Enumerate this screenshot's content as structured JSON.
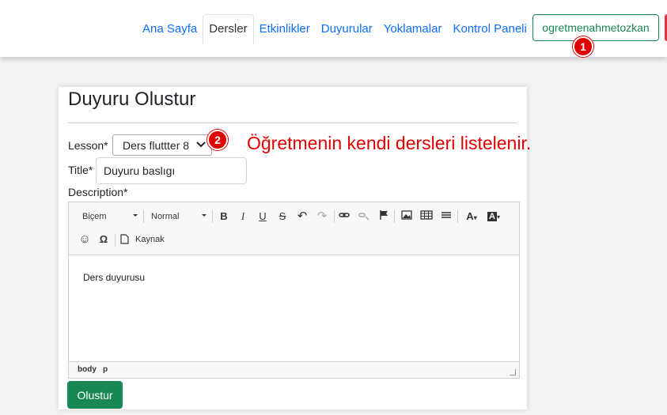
{
  "nav": {
    "items": [
      "Ana Sayfa",
      "Dersler",
      "Etkinlikler",
      "Duyurular",
      "Yoklamalar",
      "Kontrol Paneli"
    ],
    "active": "Dersler",
    "user": "ogretmenahmetozkan"
  },
  "badges": {
    "one": "1",
    "two": "2"
  },
  "form": {
    "title": "Duyuru Olustur",
    "lesson_label": "Lesson*",
    "lesson_value": "Ders fluttter 8",
    "title_label": "Title*",
    "title_value": "Duyuru baslıgı",
    "description_label": "Description*",
    "submit": "Olustur"
  },
  "annotation": "Öğretmenin kendi dersleri listelenir.",
  "editor": {
    "style_combo": "Biçem",
    "format_combo": "Normal",
    "source_label": "Kaynak",
    "content": "Ders duyurusu",
    "path": [
      "body",
      "p"
    ],
    "icons": [
      "bold-icon",
      "italic-icon",
      "underline-icon",
      "strikethrough-icon",
      "undo-icon",
      "redo-icon",
      "link-icon",
      "unlink-icon",
      "anchor-icon",
      "image-icon",
      "table-icon",
      "horizontal-line-icon",
      "text-color-icon",
      "background-color-icon",
      "smiley-icon",
      "special-char-icon",
      "source-icon"
    ]
  },
  "colors": {
    "primary": "#0d6efd",
    "success": "#198754",
    "annotation": "#e00000"
  }
}
